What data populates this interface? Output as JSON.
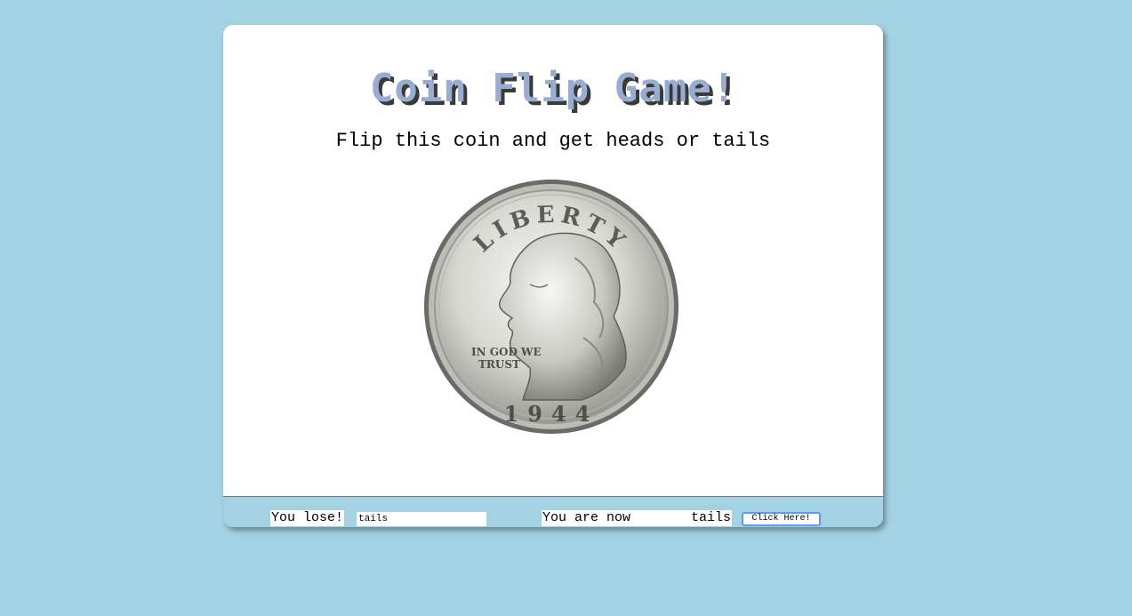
{
  "game": {
    "title": "Coin Flip Game!",
    "subtitle": "Flip this coin and get heads or tails",
    "title_color": "#97aed2",
    "background_color": "#a3d2e2"
  },
  "coin": {
    "icon": "coin-heads-icon",
    "legend": "LIBERTY",
    "motto_line1": "IN GOD WE",
    "motto_line2": "TRUST",
    "year": "1944"
  },
  "footer": {
    "result_text": "You lose!",
    "guess_value": "tails",
    "status_prefix": "You are now",
    "status_value": "tails",
    "button_label": "Click Here!"
  }
}
